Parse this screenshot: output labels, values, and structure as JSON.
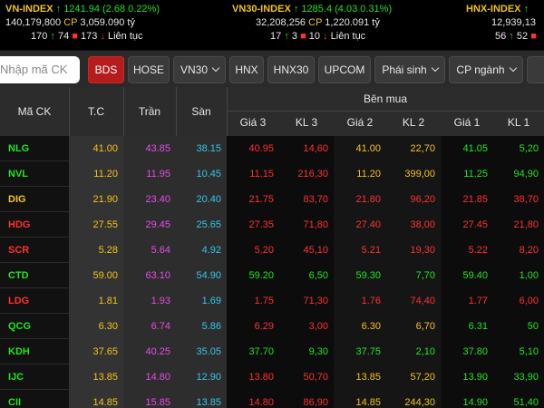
{
  "indices": [
    {
      "name": "VN-INDEX",
      "value": "1241.94",
      "change": "(2.68 0.22%)",
      "volume": "140,179,800",
      "cp_label": "CP",
      "cp_value": "3,059.090 tỷ",
      "up_count": "170",
      "ref_count": "74",
      "down_count": "173",
      "session": "Liên tục"
    },
    {
      "name": "VN30-INDEX",
      "value": "1285.4",
      "change": "(4.03 0.31%)",
      "volume": "32,208,256",
      "cp_label": "CP",
      "cp_value": "1,220.091 tỷ",
      "up_count": "17",
      "ref_count": "3",
      "down_count": "10",
      "session": "Liên tục"
    },
    {
      "name": "HNX-INDEX",
      "value": "",
      "change": "",
      "volume": "12,939,13",
      "cp_label": "",
      "cp_value": "",
      "up_count": "56",
      "ref_count": "52",
      "down_count": "",
      "session": ""
    }
  ],
  "toolbar": {
    "search_placeholder": "Nhập mã CK",
    "buttons": [
      "BDS",
      "HOSE",
      "VN30",
      "HNX",
      "HNX30",
      "UPCOM",
      "Phái sinh",
      "CP ngành"
    ],
    "active": "BDS"
  },
  "table": {
    "headers": {
      "symbol": "Mã CK",
      "ref": "T.C",
      "ceil": "Trần",
      "floor": "Sàn",
      "group_buy": "Bên mua",
      "price3": "Giá 3",
      "vol3": "KL 3",
      "price2": "Giá 2",
      "vol2": "KL 2",
      "price1": "Giá 1",
      "vol1": "KL 1"
    },
    "rows": [
      {
        "symbol": "NLG",
        "ref": "41.00",
        "ceil": "43.85",
        "floor": "38.15",
        "p3": "40.95",
        "v3": "14,60",
        "p2": "41.00",
        "v2": "22,70",
        "p1": "41.05",
        "v1": "5,20",
        "c3": "dn",
        "c2": "ref",
        "c1": "up",
        "sc": "up"
      },
      {
        "symbol": "NVL",
        "ref": "11.20",
        "ceil": "11.95",
        "floor": "10.45",
        "p3": "11.15",
        "v3": "216,30",
        "p2": "11.20",
        "v2": "399,00",
        "p1": "11.25",
        "v1": "94,90",
        "c3": "dn",
        "c2": "ref",
        "c1": "up",
        "sc": "up"
      },
      {
        "symbol": "DIG",
        "ref": "21.90",
        "ceil": "23.40",
        "floor": "20.40",
        "p3": "21.75",
        "v3": "83,70",
        "p2": "21.80",
        "v2": "96,20",
        "p1": "21.85",
        "v1": "38,70",
        "c3": "dn",
        "c2": "dn",
        "c1": "dn",
        "sc": "ref"
      },
      {
        "symbol": "HDG",
        "ref": "27.55",
        "ceil": "29.45",
        "floor": "25.65",
        "p3": "27.35",
        "v3": "71,80",
        "p2": "27.40",
        "v2": "38,00",
        "p1": "27.45",
        "v1": "21,80",
        "c3": "dn",
        "c2": "dn",
        "c1": "dn",
        "sc": "dn"
      },
      {
        "symbol": "SCR",
        "ref": "5.28",
        "ceil": "5.64",
        "floor": "4.92",
        "p3": "5.20",
        "v3": "45,10",
        "p2": "5.21",
        "v2": "19,30",
        "p1": "5.22",
        "v1": "8,20",
        "c3": "dn",
        "c2": "dn",
        "c1": "dn",
        "sc": "dn"
      },
      {
        "symbol": "CTD",
        "ref": "59.00",
        "ceil": "63.10",
        "floor": "54.90",
        "p3": "59.20",
        "v3": "6,50",
        "p2": "59.30",
        "v2": "7,70",
        "p1": "59.40",
        "v1": "1,00",
        "c3": "up",
        "c2": "up",
        "c1": "up",
        "sc": "up"
      },
      {
        "symbol": "LDG",
        "ref": "1.81",
        "ceil": "1.93",
        "floor": "1.69",
        "p3": "1.75",
        "v3": "71,30",
        "p2": "1.76",
        "v2": "74,40",
        "p1": "1.77",
        "v1": "6,00",
        "c3": "dn",
        "c2": "dn",
        "c1": "dn",
        "sc": "dn"
      },
      {
        "symbol": "QCG",
        "ref": "6.30",
        "ceil": "6.74",
        "floor": "5.86",
        "p3": "6.29",
        "v3": "3,00",
        "p2": "6.30",
        "v2": "6,70",
        "p1": "6.31",
        "v1": "50",
        "c3": "dn",
        "c2": "ref",
        "c1": "up",
        "sc": "up"
      },
      {
        "symbol": "KDH",
        "ref": "37.65",
        "ceil": "40.25",
        "floor": "35.05",
        "p3": "37.70",
        "v3": "9,30",
        "p2": "37.75",
        "v2": "2,10",
        "p1": "37.80",
        "v1": "5,10",
        "c3": "up",
        "c2": "up",
        "c1": "up",
        "sc": "up"
      },
      {
        "symbol": "IJC",
        "ref": "13.85",
        "ceil": "14.80",
        "floor": "12.90",
        "p3": "13.80",
        "v3": "50,70",
        "p2": "13.85",
        "v2": "57,20",
        "p1": "13.90",
        "v1": "33,90",
        "c3": "dn",
        "c2": "ref",
        "c1": "up",
        "sc": "up"
      },
      {
        "symbol": "CII",
        "ref": "14.85",
        "ceil": "15.85",
        "floor": "13.85",
        "p3": "14.80",
        "v3": "86,90",
        "p2": "14.85",
        "v2": "244,30",
        "p1": "14.90",
        "v1": "51,40",
        "c3": "dn",
        "c2": "ref",
        "c1": "up",
        "sc": "up"
      }
    ]
  },
  "colors": {
    "up": "#1ee61e",
    "down": "#ff3030",
    "ref": "#f0c419",
    "ceil": "#e64ce6",
    "floor": "#35c6e6",
    "active_tab": "#b71c1c"
  }
}
